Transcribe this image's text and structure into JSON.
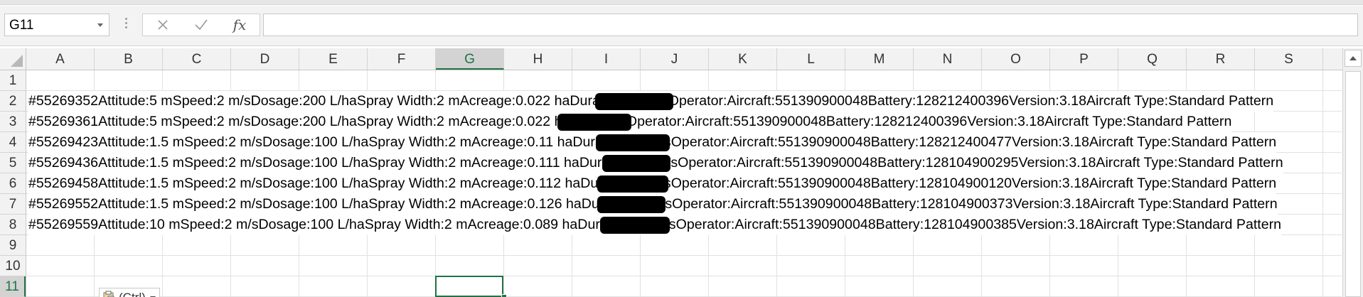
{
  "formula_bar": {
    "name_box": "G11",
    "fx_label": "fx",
    "formula_value": ""
  },
  "columns": [
    "A",
    "B",
    "C",
    "D",
    "E",
    "F",
    "G",
    "H",
    "I",
    "J",
    "K",
    "L",
    "M",
    "N",
    "O",
    "P",
    "Q",
    "R",
    "S"
  ],
  "active_column": "G",
  "rows": [
    {
      "num": "1",
      "text": ""
    },
    {
      "num": "2",
      "text": "#55269352Attitude:5 mSpeed:2 m/sDosage:200 L/haSpray Width:2 mAcreage:0.022 haDuration:5m15sOperator:",
      "tail": "Aircraft:551390900048Battery:128212400396Version:3.18Aircraft Type:Standard Pattern"
    },
    {
      "num": "3",
      "text": "#55269361Attitude:5 mSpeed:2 m/sDosage:200 L/haSpray Width:2 mAcreage:0.022 haDuration:Operator:",
      "tail": "Aircraft:551390900048Battery:128212400396Version:3.18Aircraft Type:Standard Pattern"
    },
    {
      "num": "4",
      "text": "#55269423Attitude:1.5 mSpeed:2 m/sDosage:100 L/haSpray Width:2 mAcreage:0.11 haDuration:6m53sOperator:",
      "tail": "Aircraft:551390900048Battery:128212400477Version:3.18Aircraft Type:Standard Pattern"
    },
    {
      "num": "5",
      "text": "#55269436Attitude:1.5 mSpeed:2 m/sDosage:100 L/haSpray Width:2 mAcreage:0.111 haDuration:6m59sOperator:",
      "tail": "Aircraft:551390900048Battery:128104900295Version:3.18Aircraft Type:Standard Pattern"
    },
    {
      "num": "6",
      "text": "#55269458Attitude:1.5 mSpeed:2 m/sDosage:100 L/haSpray Width:2 mAcreage:0.112 haDuration:7m4sOperator:",
      "tail": "Aircraft:551390900048Battery:128104900120Version:3.18Aircraft Type:Standard Pattern"
    },
    {
      "num": "7",
      "text": "#55269552Attitude:1.5 mSpeed:2 m/sDosage:100 L/haSpray Width:2 mAcreage:0.126 haDuration:8m9sOperator:",
      "tail": "Aircraft:551390900048Battery:128104900373Version:3.18Aircraft Type:Standard Pattern"
    },
    {
      "num": "8",
      "text": "#55269559Attitude:10 mSpeed:2 m/sDosage:100 L/haSpray Width:2 mAcreage:0.089 haDuration:7m10sOperator:",
      "tail": "Aircraft:551390900048Battery:128104900385Version:3.18Aircraft Type:Standard Pattern"
    },
    {
      "num": "9",
      "text": ""
    },
    {
      "num": "10",
      "text": ""
    },
    {
      "num": "11",
      "text": ""
    }
  ],
  "active_row": "11",
  "paste_options": {
    "label": "(Ctrl)",
    "icon": "clipboard-icon"
  },
  "colors": {
    "accent": "#217346",
    "header_bg": "#f2f2f2",
    "gridline": "#e1e1e1"
  }
}
